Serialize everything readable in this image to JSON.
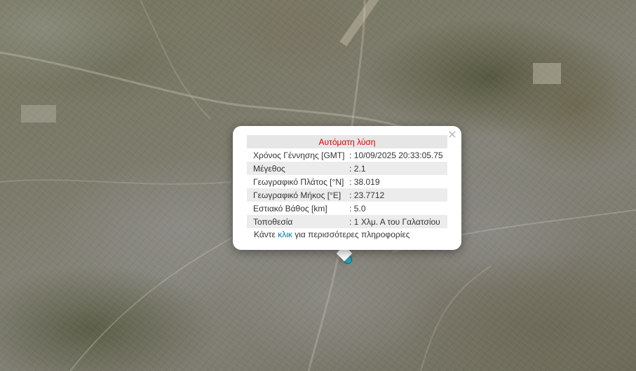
{
  "popup": {
    "title": "Αυτόματη λύση",
    "rows": [
      {
        "label": "Χρόνος Γέννησης [GMT]",
        "value": ": 10/09/2025 20:33:05.75"
      },
      {
        "label": "Μέγεθος",
        "value": ": 2.1"
      },
      {
        "label": "Γεωγραφικό Πλάτος [°N]",
        "value": ": 38.019"
      },
      {
        "label": "Γεωγραφικό Μήκος [°E]",
        "value": ": 23.7712"
      },
      {
        "label": "Εστιακό Βάθος [km]",
        "value": ": 5.0"
      },
      {
        "label": "Τοποθεσία",
        "value": ": 1 Χλμ. Α του Γαλατσίου"
      }
    ],
    "more_prefix": "Κάντε ",
    "more_link": "κλικ",
    "more_suffix": " για περισσότερες πληροφορίες",
    "close_label": "×"
  },
  "marker_color": "#2bb3c7",
  "title_color": "#e00000"
}
